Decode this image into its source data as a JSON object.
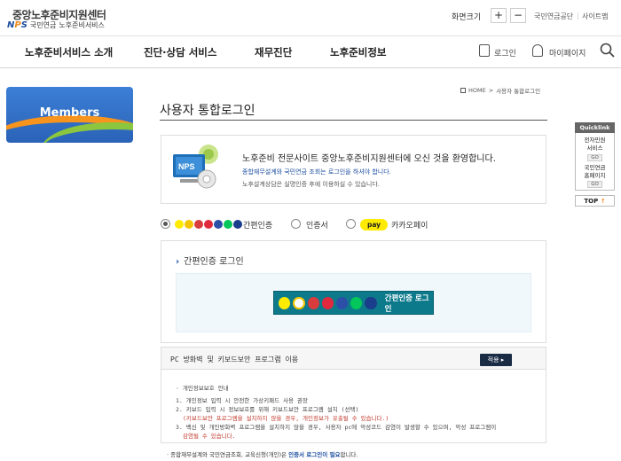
{
  "site": {
    "title": "중앙노후준비지원센터",
    "sub_brand": "국민연금",
    "sub_text": "노후준비서비스"
  },
  "top": {
    "font_size_label": "화면크기",
    "zoom_in": "+",
    "zoom_out": "−",
    "links": [
      "국민연금공단",
      "사이트맵"
    ]
  },
  "nav": {
    "items": [
      "노후준비서비스 소개",
      "진단·상담 서비스",
      "재무진단",
      "노후준비정보"
    ],
    "login": "로그인",
    "mypage": "마이페이지"
  },
  "side": {
    "members_label": "Members"
  },
  "breadcrumb": {
    "home": "HOME",
    "sep": ">",
    "current": "사용자 통합로그인"
  },
  "page": {
    "title": "사용자 통합로그인"
  },
  "welcome": {
    "main": "노후준비 전문사이트 중앙노후준비지원센터에 오신 것을 환영합니다.",
    "line1": "종합재무설계와 국민연금 조회는 로그인을 하셔야 합니다.",
    "line2": "노후설계상담은 실명인증 후에 이용하실 수 있습니다.",
    "badge": "NPS"
  },
  "methods": {
    "easy": "간편인증",
    "cert": "인증서",
    "kakao": "카카오페이",
    "pay_badge": "pay",
    "selected": "easy"
  },
  "panel": {
    "title": "간편인증 로그인",
    "button_label": "간편인증 로그인"
  },
  "security": {
    "title": "PC 방화벽 및 키보드보안 프로그램 이용",
    "apply": "적용",
    "lines": [
      "· 개인정보보호 안내",
      "1. 개인정보 입력 시 안전한 가상키패드 사용 권장",
      "2. 키보드 입력 시 정보보호를 위해 키보드보안 프로그램 설치 (선택)",
      "(키보드보안 프로그램을 설치하지 않을 경우, 개인정보가 유출될 수 있습니다.)",
      "3. 백신 및 개인방화벽 프로그램을 설치하지 않을 경우, 사용자 pc에 악성코드 감염이 발생할 수 있으며, 악성 프로그램이",
      "감염될 수 있습니다."
    ],
    "footnote_pre": "· 종합재무설계와 국민연금조회, 교육신청(개인)은",
    "footnote_bold": "인증서 로그인이 필요",
    "footnote_post": "합니다."
  },
  "quicklink": {
    "head": "Quicklink",
    "items": [
      {
        "label1": "전자민원",
        "label2": "서비스",
        "go": "GO"
      },
      {
        "label1": "국민연금",
        "label2": "홈페이지",
        "go": "GO"
      }
    ],
    "top": "TOP"
  }
}
